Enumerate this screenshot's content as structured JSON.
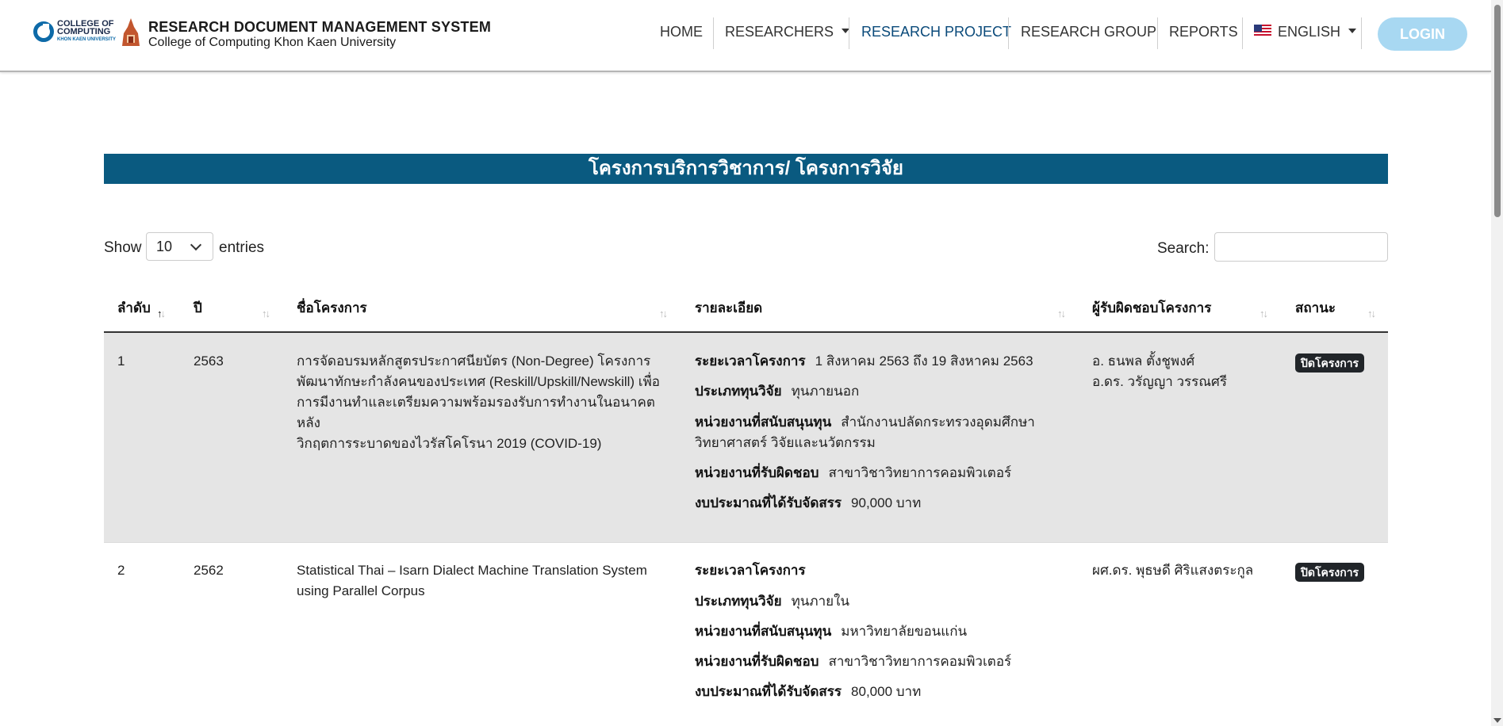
{
  "header": {
    "logo_text_1": "COLLEGE OF",
    "logo_text_2": "COMPUTING",
    "logo_text_3": "KHON KAEN UNIVERSITY",
    "title": "RESEARCH DOCUMENT MANAGEMENT SYSTEM",
    "subtitle": "College of Computing Khon Kaen University",
    "nav": {
      "home": "HOME",
      "researchers": "RESEARCHERS",
      "research_project": "RESEARCH PROJECT",
      "research_group": "RESEARCH GROUP",
      "reports": "REPORTS",
      "language": "ENGLISH"
    },
    "login": "LOGIN"
  },
  "banner": "โครงการบริการวิชาการ/ โครงการวิจัย",
  "controls": {
    "show": "Show",
    "entries_value": "10",
    "entries": "entries",
    "search": "Search:"
  },
  "table": {
    "headers": [
      "ลำดับ",
      "ปี",
      "ชื่อโครงการ",
      "รายละเอียด",
      "ผู้รับผิดชอบโครงการ",
      "สถานะ"
    ],
    "detail_labels": {
      "period": "ระยะเวลาโครงการ",
      "fund_type": "ประเภททุนวิจัย",
      "sponsor": "หน่วยงานที่สนับสนุนทุน",
      "responsible_unit": "หน่วยงานที่รับผิดชอบ",
      "budget": "งบประมาณที่ได้รับจัดสรร"
    },
    "rows": [
      {
        "no": "1",
        "year": "2563",
        "name_lines": [
          "การจัดอบรมหลักสูตรประกาศนียบัตร (Non-Degree) โครงการ",
          "พัฒนาทักษะกำลังคนของประเทศ (Reskill/Upskill/Newskill) เพื่อ",
          "การมีงานทำและเตรียมความพร้อมรองรับการทำงานในอนาคตหลัง",
          "วิกฤตการระบาดของไวรัสโคโรนา 2019 (COVID-19)"
        ],
        "period": "1 สิงหาคม 2563 ถึง 19 สิงหาคม 2563",
        "fund_type": "ทุนภายนอก",
        "sponsor_lines": [
          "สำนักงานปลัดกระทรวงอุดมศึกษา",
          "วิทยาศาสตร์ วิจัยและนวัตกรรม"
        ],
        "responsible_unit": "สาขาวิชาวิทยาการคอมพิวเตอร์",
        "budget": "90,000 บาท",
        "people": [
          "อ. ธนพล ตั้งชูพงศ์",
          "อ.ดร. วรัญญา วรรณศรี"
        ],
        "status": "ปิดโครงการ"
      },
      {
        "no": "2",
        "year": "2562",
        "name_lines": [
          "Statistical Thai – Isarn Dialect Machine Translation System",
          "using Parallel Corpus"
        ],
        "period": "",
        "fund_type": "ทุนภายใน",
        "sponsor_lines": [
          "มหาวิทยาลัยขอนแก่น"
        ],
        "responsible_unit": "สาขาวิชาวิทยาการคอมพิวเตอร์",
        "budget": "80,000 บาท",
        "people": [
          "ผศ.ดร. พุธษดี ศิริแสงตระกูล"
        ],
        "status": "ปิดโครงการ"
      }
    ]
  },
  "colors": {
    "banner": "#0a5a80",
    "active_nav": "#0a4a7a",
    "login": "#a8d8f2",
    "row_highlight": "#e5e5e5",
    "badge": "#212529"
  }
}
